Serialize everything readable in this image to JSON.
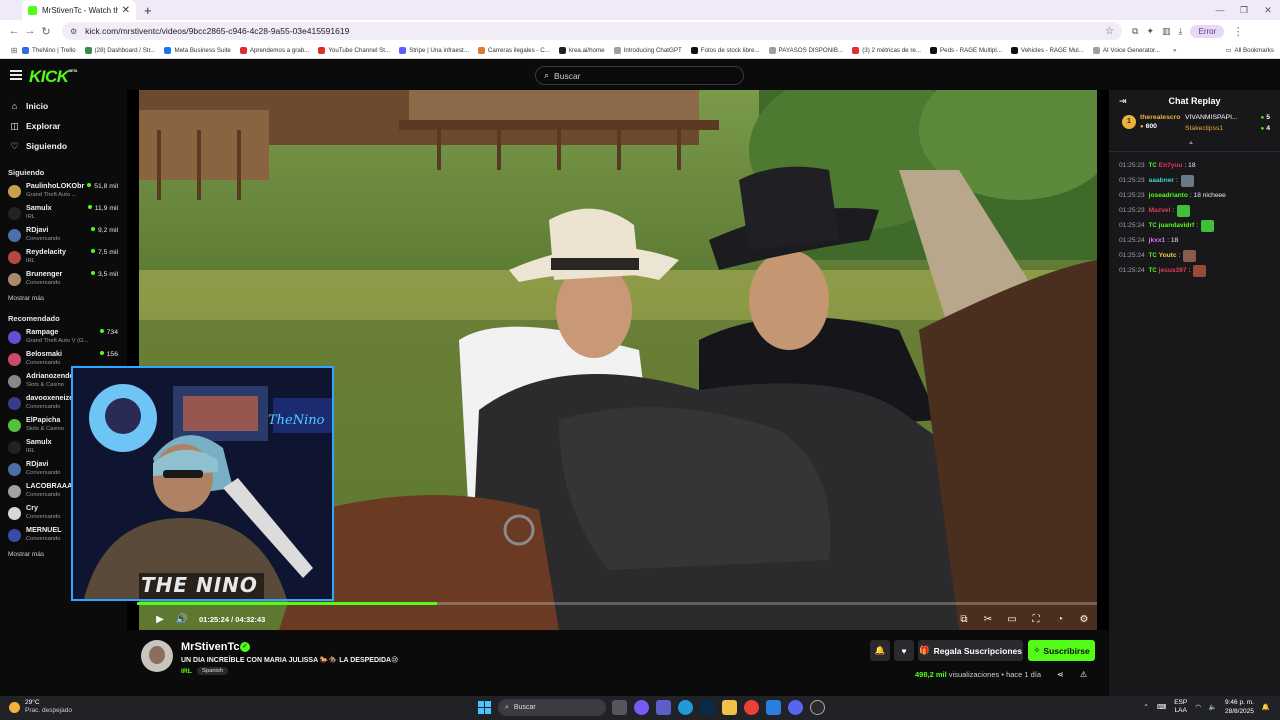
{
  "browser": {
    "tab_title": "MrStivenTc - Watch the VOD o",
    "url": "kick.com/mrstiventc/videos/9bcc2865-c946-4c28-9a55-03e415591619",
    "profile_label": "Error",
    "bookmarks": [
      {
        "label": "TheNino | Trello",
        "color": "#2f6fe0"
      },
      {
        "label": "(28) Dashboard / Str...",
        "color": "#3c8a4a"
      },
      {
        "label": "Meta Business Suite",
        "color": "#1877f2"
      },
      {
        "label": "Aprendemos a grab...",
        "color": "#e02d2d"
      },
      {
        "label": "YouTube Channel St...",
        "color": "#e02d2d"
      },
      {
        "label": "Stripe | Una infraest...",
        "color": "#635bff"
      },
      {
        "label": "Carreras ilegales - C...",
        "color": "#e07a2d"
      },
      {
        "label": "krea.ai/home",
        "color": "#222222"
      },
      {
        "label": "Introducing ChatGPT",
        "color": "#9aa0a6"
      },
      {
        "label": "Fotos de stock libre...",
        "color": "#111111"
      },
      {
        "label": "PAYASOS DISPONIB...",
        "color": "#9aa0a6"
      },
      {
        "label": "(3) 2 métricas de re...",
        "color": "#e02d2d"
      },
      {
        "label": "Peds - RAGE Multipl...",
        "color": "#111111"
      },
      {
        "label": "Vehicles - RAGE Mul...",
        "color": "#111111"
      },
      {
        "label": "AI Voice Generator...",
        "color": "#9aa0a6"
      }
    ],
    "all_bookmarks": "All Bookmarks"
  },
  "header": {
    "logo_text": "KICK",
    "logo_badge": "BETA",
    "search_placeholder": "Buscar"
  },
  "sidebar": {
    "nav": [
      {
        "label": "Inicio",
        "icon": "home-icon",
        "glyph": "⌂"
      },
      {
        "label": "Explorar",
        "icon": "compass-icon",
        "glyph": "◫"
      },
      {
        "label": "Siguiendo",
        "icon": "heart-icon",
        "glyph": "♡"
      }
    ],
    "following_title": "Siguiendo",
    "following": [
      {
        "name": "PaulinhoLOKObr",
        "category": "Grand Theft Auto ...",
        "viewers": "51,8 mil",
        "color": "#c9a14a"
      },
      {
        "name": "Samulx",
        "category": "IRL",
        "viewers": "11,9 mil",
        "color": "#222222"
      },
      {
        "name": "RDjavi",
        "category": "Conversando",
        "viewers": "9,2 mil",
        "color": "#4b6fa8"
      },
      {
        "name": "Reydelacity",
        "category": "IRL",
        "viewers": "7,5 mil",
        "color": "#b4483c"
      },
      {
        "name": "Brunenger",
        "category": "Conversando",
        "viewers": "3,5 mil",
        "color": "#a88c6a"
      }
    ],
    "show_more": "Mostrar más",
    "recommended_title": "Recomendado",
    "recommended": [
      {
        "name": "Rampage",
        "category": "Grand Theft Auto V (G...",
        "viewers": "734",
        "color": "#6a4bd1"
      },
      {
        "name": "Belosmaki",
        "category": "Conversando",
        "viewers": "156",
        "color": "#c94a6a"
      },
      {
        "name": "Adrianozende",
        "category": "Slots & Casino",
        "viewers": "",
        "color": "#888888"
      },
      {
        "name": "davooxeneize",
        "category": "Conversando",
        "viewers": "",
        "color": "#3a3a8a"
      },
      {
        "name": "ElPapicha",
        "category": "Slots & Casino",
        "viewers": "",
        "color": "#53c13a"
      },
      {
        "name": "Samulx",
        "category": "IRL",
        "viewers": "",
        "color": "#222222"
      },
      {
        "name": "RDjavi",
        "category": "Conversando",
        "viewers": "",
        "color": "#4b6fa8"
      },
      {
        "name": "LACOBRAAA",
        "category": "Conversando",
        "viewers": "",
        "color": "#a0a0a0"
      },
      {
        "name": "Cry",
        "category": "Conversando",
        "viewers": "",
        "color": "#d8d8d8"
      },
      {
        "name": "MERNUEL",
        "category": "Conversando",
        "viewers": "",
        "color": "#3a4aa8"
      }
    ],
    "show_more_2": "Mostrar más"
  },
  "player": {
    "time": "01:25:24 / 04:32:43",
    "progress_fraction": 0.313,
    "facecam_text": "THE NINO",
    "facecam_neon": "TheNino"
  },
  "chat": {
    "title": "Chat Replay",
    "top_supporter": {
      "rank": "1",
      "name": "therealescro",
      "amount": "600"
    },
    "supporters": [
      {
        "name": "VIVANMISPAPI...",
        "count": "5"
      },
      {
        "name": "Stakeclipss1",
        "count": "4"
      }
    ],
    "messages": [
      {
        "time": "01:25:23",
        "badge": "TC",
        "user": "En7yuu",
        "color": "#e23b5b",
        "text": ": 18",
        "emote": ""
      },
      {
        "time": "01:25:23",
        "badge": "",
        "user": "aaabner",
        "color": "#3bd5c9",
        "text": ":",
        "emote": "#6a7a8a"
      },
      {
        "time": "01:25:23",
        "badge": "",
        "user": "joseadrianto",
        "color": "#53fc18",
        "text": ": 18 nicheee",
        "emote": ""
      },
      {
        "time": "01:25:23",
        "badge": "",
        "user": "Mazvel",
        "color": "#e23b5b",
        "text": ":",
        "emote": "#3fbf3a"
      },
      {
        "time": "01:25:24",
        "badge": "TC",
        "user": "juandavidrf",
        "color": "#53fc18",
        "text": ":",
        "emote": "#3fbf3a"
      },
      {
        "time": "01:25:24",
        "badge": "",
        "user": "jkxx1",
        "color": "#c87bf0",
        "text": ": 18",
        "emote": ""
      },
      {
        "time": "01:25:24",
        "badge": "TC",
        "user": "Youtc",
        "color": "#f2d23b",
        "text": ":",
        "emote": "#8a5a4a"
      },
      {
        "time": "01:25:24",
        "badge": "TC",
        "user": "jesus397",
        "color": "#e23b5b",
        "text": ":",
        "emote": "#9a4a3a"
      }
    ]
  },
  "stream": {
    "channel": "MrStivenTc",
    "title": "UN DIA INCREÍBLE CON MARIA JULISSA 🐎🏇 LA DESPEDIDA😢",
    "category": "IRL",
    "tag": "Spanish",
    "gift_label": "Regala Suscripciones",
    "subscribe_label": "Suscribirse",
    "views": "498,2 mil",
    "views_label": "visualizaciones",
    "age": "hace 1 día"
  },
  "taskbar": {
    "temp": "29°C",
    "weather": "Prac. despejado",
    "search_placeholder": "Buscar",
    "lang_1": "ESP",
    "lang_2": "LAA",
    "time": "9:46 p. m.",
    "date": "28/8/2025"
  }
}
